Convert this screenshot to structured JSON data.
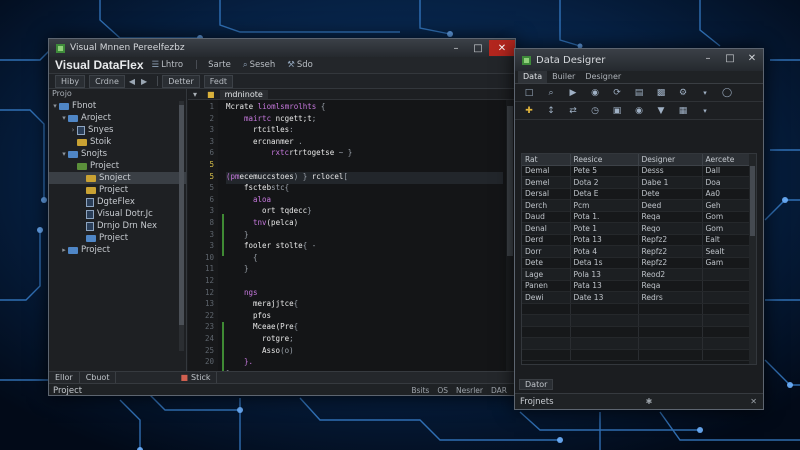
{
  "ide": {
    "title": "Visual Mnnen Pereelfezbz",
    "brand": "Visual DataFlex",
    "menu": [
      {
        "label": "Lhtro",
        "icon": "list-icon"
      },
      {
        "label": "Sarte",
        "icon": ""
      },
      {
        "label": "Seseh",
        "icon": "search-icon"
      },
      {
        "label": "Sdo",
        "icon": "tool-icon"
      }
    ],
    "toolbar": [
      "Hiby",
      "Crdne",
      "Detter",
      "Fedt"
    ],
    "explorer": {
      "header": "Projo",
      "items": [
        {
          "label": "Fbnot",
          "level": 0,
          "toggle": "▾",
          "icon": "folder-blue"
        },
        {
          "label": "Aroject",
          "level": 1,
          "toggle": "▾",
          "icon": "folder-blue"
        },
        {
          "label": "Snyes",
          "level": 2,
          "toggle": "›",
          "icon": "file"
        },
        {
          "label": "Stoik",
          "level": 2,
          "toggle": "",
          "icon": "folder-yellow"
        },
        {
          "label": "Snojts",
          "level": 1,
          "toggle": "▾",
          "icon": "folder-blue"
        },
        {
          "label": "Project",
          "level": 2,
          "toggle": "",
          "icon": "folder-green"
        },
        {
          "label": "Snoject",
          "level": 3,
          "toggle": "",
          "icon": "folder-yellow",
          "selected": true
        },
        {
          "label": "Project",
          "level": 3,
          "toggle": "",
          "icon": "folder-yellow"
        },
        {
          "label": "DgteFlex",
          "level": 3,
          "toggle": "",
          "icon": "file"
        },
        {
          "label": "Visual Dotr.Jc",
          "level": 3,
          "toggle": "",
          "icon": "file"
        },
        {
          "label": "Drnjo Drn Nex",
          "level": 3,
          "toggle": "",
          "icon": "file"
        },
        {
          "label": "Project",
          "level": 3,
          "toggle": "",
          "icon": "folder-blue"
        },
        {
          "label": "Project",
          "level": 1,
          "toggle": "▸",
          "icon": "folder-blue"
        }
      ]
    },
    "editor": {
      "tab_active": "mdninote",
      "line_numbers": [
        "1",
        "2",
        "3",
        "3",
        "6",
        "5",
        "5",
        "5",
        "6",
        "3",
        "8",
        "3",
        "3",
        "10",
        "11",
        "12",
        "12",
        "13",
        "22",
        "23",
        "24",
        "25",
        "20"
      ],
      "lines": [
        {
          "indent": 0,
          "parts": [
            {
              "t": "Mcrate ",
              "c": "fn"
            },
            {
              "t": "liomlsmrolhts",
              "c": "kw"
            },
            {
              "t": " {",
              "c": "punc"
            }
          ]
        },
        {
          "indent": 2,
          "parts": [
            {
              "t": "mairtc ",
              "c": "kw"
            },
            {
              "t": "ncgett;t",
              "c": "fn"
            },
            {
              "t": ";",
              "c": "punc"
            }
          ]
        },
        {
          "indent": 3,
          "parts": [
            {
              "t": "rtcitles",
              "c": "fn"
            },
            {
              "t": ":",
              "c": "punc"
            }
          ]
        },
        {
          "indent": 3,
          "parts": [
            {
              "t": "ercnanmer",
              "c": "fn"
            },
            {
              "t": " .",
              "c": "punc"
            }
          ]
        },
        {
          "indent": 5,
          "parts": [
            {
              "t": "rxtc",
              "c": "kw"
            },
            {
              "t": "rtrtogetse",
              "c": "fn"
            },
            {
              "t": " ~    }",
              "c": "punc"
            }
          ]
        },
        {
          "indent": 0,
          "parts": []
        },
        {
          "indent": 0,
          "parts": [
            {
              "t": "(pm",
              "c": "kw"
            },
            {
              "t": "ecemuccstoes",
              "c": "fn"
            },
            {
              "t": ")  }  ",
              "c": "punc"
            },
            {
              "t": "rclocel",
              "c": "fn"
            },
            {
              "t": "[",
              "c": "punc"
            }
          ]
        },
        {
          "indent": 2,
          "parts": [
            {
              "t": "fscteb",
              "c": "fn"
            },
            {
              "t": "stc{",
              "c": "punc"
            }
          ]
        },
        {
          "indent": 3,
          "parts": [
            {
              "t": "aloa",
              "c": "kw"
            }
          ]
        },
        {
          "indent": 4,
          "parts": [
            {
              "t": "ort ",
              "c": "fn"
            },
            {
              "t": "tqdecc",
              "c": "fn"
            },
            {
              "t": "}",
              "c": "punc"
            }
          ]
        },
        {
          "indent": 3,
          "parts": [
            {
              "t": "tnv",
              "c": "kw"
            },
            {
              "t": "(pe",
              "c": "fn"
            },
            {
              "t": "lca)",
              "c": "fn"
            }
          ]
        },
        {
          "indent": 2,
          "parts": [
            {
              "t": "}",
              "c": "punc"
            }
          ]
        },
        {
          "indent": 2,
          "parts": [
            {
              "t": "fooler ",
              "c": "fn"
            },
            {
              "t": "stolte",
              "c": "fn"
            },
            {
              "t": "{    -",
              "c": "punc"
            }
          ]
        },
        {
          "indent": 3,
          "parts": [
            {
              "t": "{",
              "c": "punc"
            }
          ]
        },
        {
          "indent": 2,
          "parts": [
            {
              "t": "}",
              "c": "punc"
            }
          ]
        },
        {
          "indent": 0,
          "parts": []
        },
        {
          "indent": 2,
          "parts": [
            {
              "t": "ngs",
              "c": "kw"
            }
          ]
        },
        {
          "indent": 3,
          "parts": [
            {
              "t": "merajjtce",
              "c": "fn"
            },
            {
              "t": "{",
              "c": "punc"
            }
          ]
        },
        {
          "indent": 3,
          "parts": [
            {
              "t": "pfos",
              "c": "fn"
            }
          ]
        },
        {
          "indent": 3,
          "parts": [
            {
              "t": "Mceae",
              "c": "fn"
            },
            {
              "t": "(Pre",
              "c": "fn"
            },
            {
              "t": "{",
              "c": "punc"
            }
          ]
        },
        {
          "indent": 4,
          "parts": [
            {
              "t": "rotgre",
              "c": "fn"
            },
            {
              "t": ";",
              "c": "punc"
            }
          ]
        },
        {
          "indent": 4,
          "parts": [
            {
              "t": "Asso",
              "c": "fn"
            },
            {
              "t": "(o)",
              "c": "punc"
            }
          ]
        },
        {
          "indent": 2,
          "parts": [
            {
              "t": "}.",
              "c": "kw"
            }
          ]
        },
        {
          "indent": 0,
          "parts": [
            {
              "t": "}",
              "c": "punc"
            }
          ]
        }
      ]
    },
    "bottom_tabs": [
      "Ellor",
      "Cbuot"
    ],
    "editor_bottom_tab": "Stick",
    "status_left": "Project",
    "status_right": [
      "Bsits",
      "OS",
      "Nesrler",
      "DAR"
    ]
  },
  "data_window": {
    "title": "Data Desigrer",
    "tabs": [
      "Data",
      "Builer",
      "Designer"
    ],
    "columns": [
      "Rat",
      "Reesice",
      "Designer",
      "Aercete"
    ],
    "rows": [
      [
        "Demal",
        "Pete 5",
        "Desss",
        "Dall"
      ],
      [
        "Demel",
        "Dota 2",
        "Dabe 1",
        "Doa"
      ],
      [
        "Dersal",
        "Deta E",
        "Dete",
        "Aa0"
      ],
      [
        "Derch",
        "Pcm",
        "Deed",
        "Geh"
      ],
      [
        "Daud",
        "Pota 1.",
        "Reqa",
        "Gom"
      ],
      [
        "Denal",
        "Pote 1",
        "Reqo",
        "Gom"
      ],
      [
        "Derd",
        "Pota 13",
        "Repfz2",
        "Ealt"
      ],
      [
        "Dorr",
        "Pota 4",
        "Repfz2",
        "Sealt"
      ],
      [
        "Dete",
        "Deta 1s",
        "Repfz2",
        "Gam"
      ],
      [
        "Lage",
        "Pola 13",
        "Reod2",
        ""
      ],
      [
        "Panen",
        "Pata 13",
        "Reqa",
        ""
      ],
      [
        "Dewi",
        "Date 13",
        "Redrs",
        ""
      ],
      [
        "",
        "",
        "",
        ""
      ],
      [
        "",
        "",
        "",
        ""
      ],
      [
        "",
        "",
        "",
        ""
      ],
      [
        "",
        "",
        "",
        ""
      ],
      [
        "",
        "",
        "",
        ""
      ]
    ],
    "bottom_tab": "Dator",
    "status": "Frojnets"
  }
}
